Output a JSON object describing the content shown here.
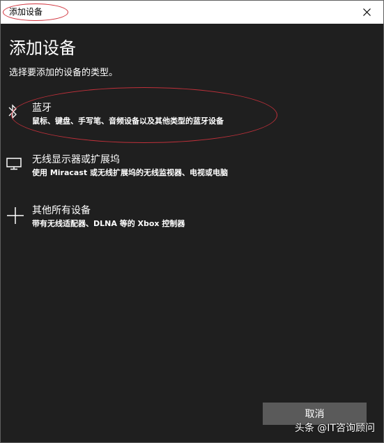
{
  "window": {
    "title": "添加设备"
  },
  "dialog": {
    "heading": "添加设备",
    "subtitle": "选择要添加的设备的类型。"
  },
  "options": [
    {
      "title": "蓝牙",
      "description": "鼠标、键盘、手写笔、音频设备以及其他类型的蓝牙设备",
      "icon": "bluetooth-icon"
    },
    {
      "title": "无线显示器或扩展坞",
      "description": "使用 Miracast 或无线扩展坞的无线监视器、电视或电脑",
      "icon": "monitor-icon"
    },
    {
      "title": "其他所有设备",
      "description": "带有无线适配器、DLNA 等的 Xbox 控制器",
      "icon": "plus-icon"
    }
  ],
  "buttons": {
    "cancel": "取消"
  },
  "watermark": "头条 @IT咨询顾问",
  "colors": {
    "background": "#1f1f1f",
    "titlebar": "#ffffff",
    "button": "#5a5a5a",
    "annotation": "#c0303a"
  }
}
